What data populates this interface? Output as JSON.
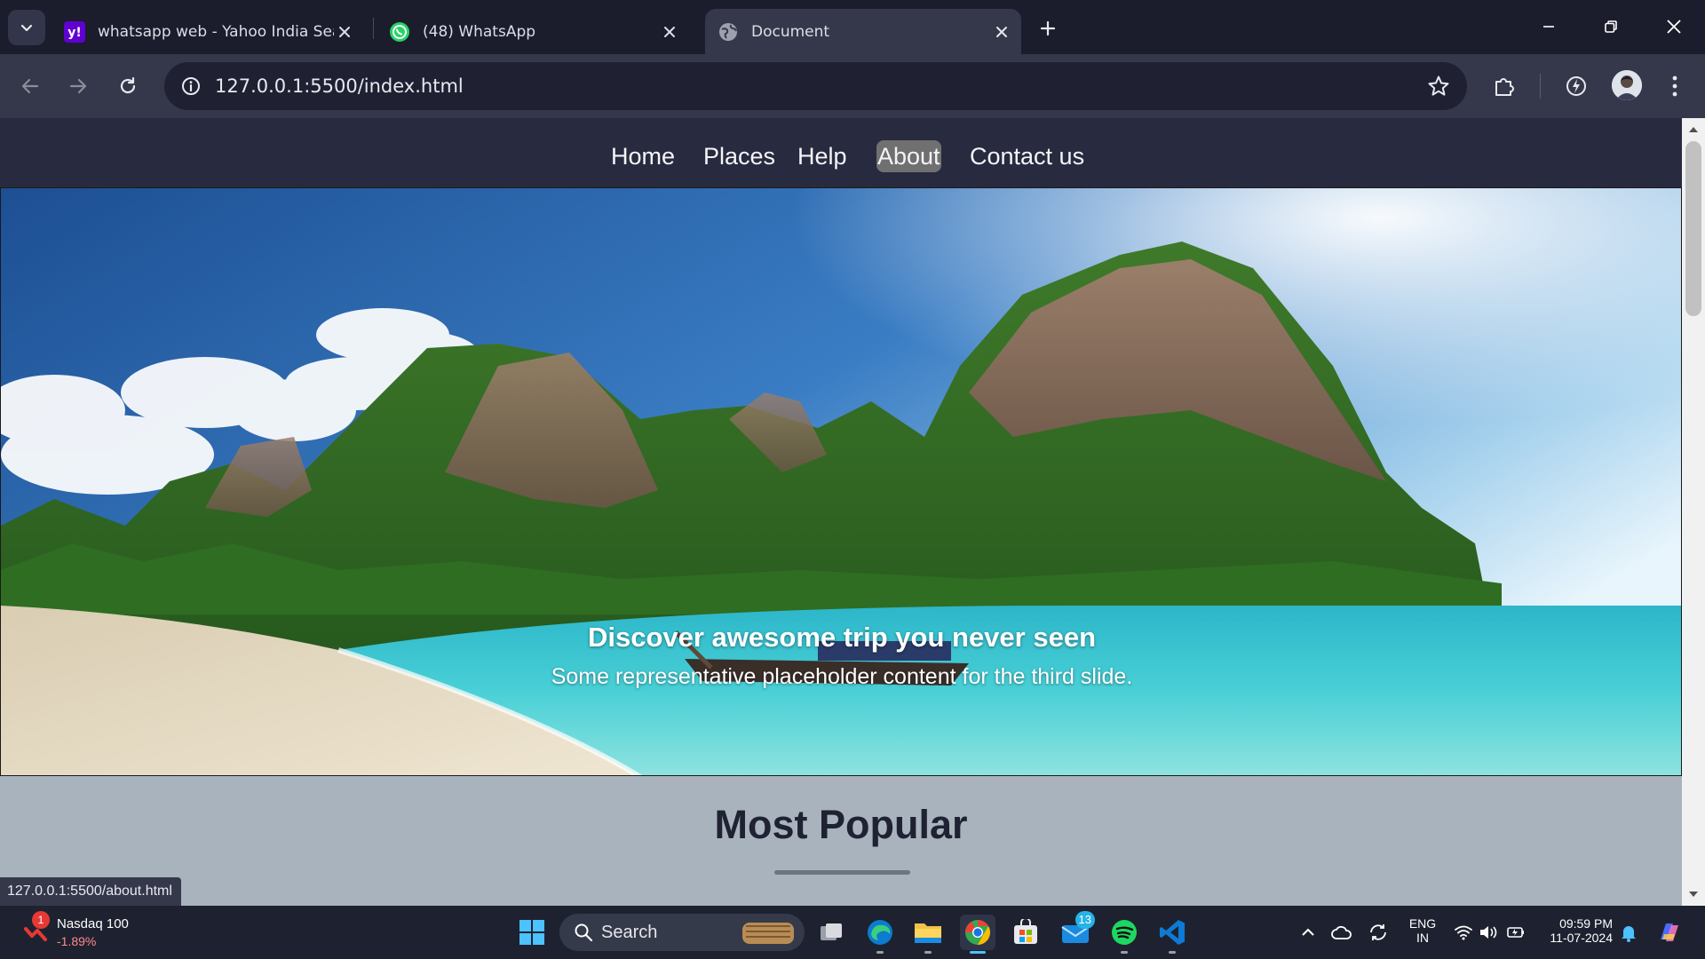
{
  "browser": {
    "tabs": [
      {
        "title": "whatsapp web - Yahoo India Search",
        "favicon": "yahoo-icon",
        "active": false
      },
      {
        "title": "(48) WhatsApp",
        "favicon": "whatsapp-icon",
        "active": false
      },
      {
        "title": "Document",
        "favicon": "globe-icon",
        "active": true
      }
    ],
    "address_bar": {
      "url": "127.0.0.1:5500/index.html"
    }
  },
  "page": {
    "nav": {
      "items": [
        {
          "label": "Home"
        },
        {
          "label": "Places"
        },
        {
          "label": "Help"
        },
        {
          "label": "About",
          "active": true
        },
        {
          "label": "Contact us"
        }
      ]
    },
    "hero": {
      "title": "Discover awesome trip you never seen",
      "subtitle": "Some representative placeholder content for the third slide."
    },
    "popular": {
      "heading": "Most Popular"
    },
    "status_url": "127.0.0.1:5500/about.html"
  },
  "taskbar": {
    "stock": {
      "name": "Nasdaq 100",
      "change": "-1.89%",
      "badge": "1"
    },
    "search_label": "Search",
    "mail_badge": "13",
    "tray": {
      "lang_line1": "ENG",
      "lang_line2": "IN",
      "time": "09:59 PM",
      "date": "11-07-2024"
    }
  },
  "colors": {
    "tab_strip": "#1b1c2c",
    "toolbar": "#35384b",
    "site_nav": "#282b3f",
    "page_background": "#a9b3bd",
    "taskbar": "#1e2230"
  }
}
